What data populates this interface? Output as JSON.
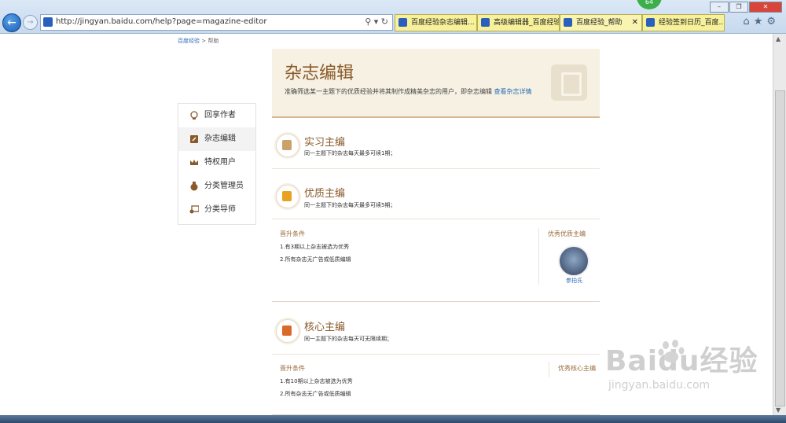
{
  "browser": {
    "url": "http://jingyan.baidu.com/help?page=magazine-editor",
    "tabs": [
      {
        "label": "百度经验杂志编辑..."
      },
      {
        "label": "高级编辑器_百度经验"
      },
      {
        "label": "百度经验_帮助",
        "close": "✕"
      },
      {
        "label": "经验签到日历_百度..."
      }
    ],
    "badge": "64"
  },
  "breadcrumb": {
    "home": "百度经验",
    "sep": ">",
    "current": "帮助"
  },
  "sidenav": {
    "items": [
      {
        "label": "回享作者",
        "icon": "bulb-icon"
      },
      {
        "label": "杂志编辑",
        "icon": "pencil-book-icon"
      },
      {
        "label": "特权用户",
        "icon": "crown-icon"
      },
      {
        "label": "分类管理员",
        "icon": "badge-icon"
      },
      {
        "label": "分类导师",
        "icon": "teacher-icon"
      }
    ]
  },
  "hero": {
    "title": "杂志编辑",
    "description": "准确筛选某一主题下的优质经验并将其制作成精美杂志的用户，即杂志编辑",
    "link": "查看杂志详情"
  },
  "ranks": [
    {
      "title": "实习主编",
      "sub": "同一主题下的杂志每天最多可续1期；",
      "color": "#c9a26a"
    },
    {
      "title": "优质主编",
      "sub": "同一主题下的杂志每天最多可续5期；",
      "color": "#e8a221"
    },
    {
      "title": "核心主编",
      "sub": "同一主题下的杂志每天可无限续期；",
      "color": "#d96a28"
    }
  ],
  "premium_block": {
    "promo_head": "晋升条件",
    "conditions": [
      "1.有3期以上杂志被选为优秀",
      "2.所有杂志无广告或低质编辑"
    ],
    "best_head": "优秀优质主编",
    "best_user": "参拍氏"
  },
  "core_block": {
    "promo_head": "晋升条件",
    "conditions": [
      "1.有10期以上杂志被选为优秀",
      "2.所有杂志无广告或低质编辑"
    ],
    "best_head": "优秀核心主编"
  },
  "watermark": {
    "brand": "Baidu经验",
    "site": "jingyan.baidu.com"
  }
}
